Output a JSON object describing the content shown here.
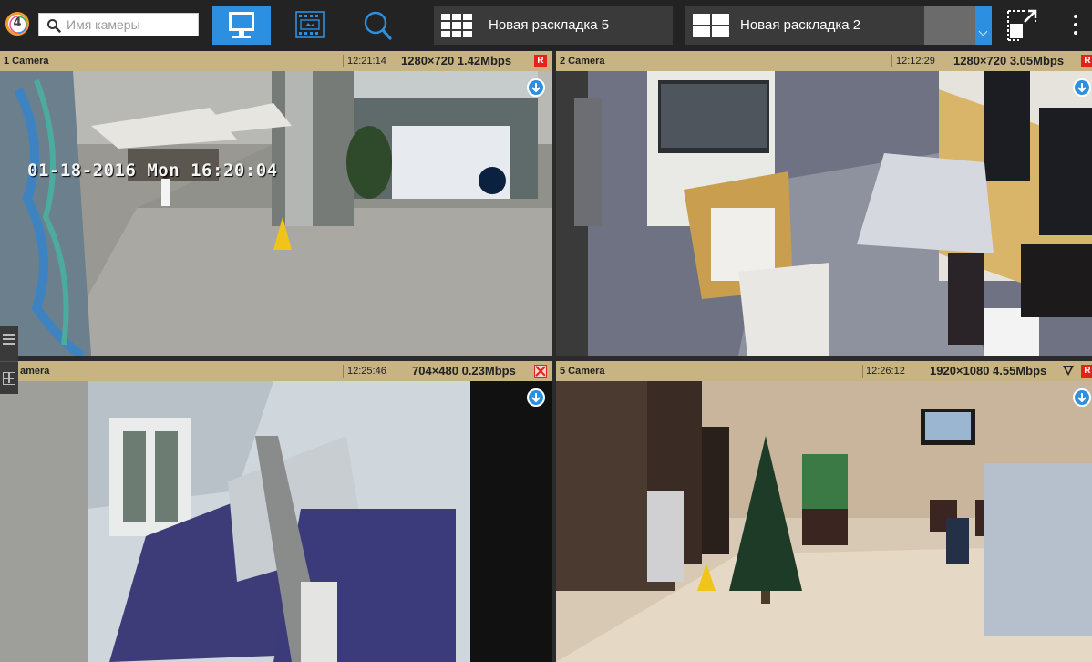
{
  "app": {
    "logo_digit": "4",
    "accent_color": "#2d8fe0",
    "header_color": "#c8b483",
    "rec_color": "#e2231a"
  },
  "toolbar": {
    "search": {
      "placeholder": "Имя камеры",
      "value": ""
    },
    "modes": [
      {
        "name": "live",
        "icon": "monitor-icon",
        "active": true
      },
      {
        "name": "archive",
        "icon": "film-icon",
        "active": false
      },
      {
        "name": "search",
        "icon": "magnifier-icon",
        "active": false
      }
    ],
    "layout_tabs": [
      {
        "label": "Новая раскладка 5",
        "icon": "layout-grid-3x3-icon"
      },
      {
        "label": "Новая раскладка 2",
        "icon": "layout-grid-2x2-icon"
      }
    ],
    "fullscreen_icon": "fullscreen-icon",
    "menu_icon": "kebab-menu-icon"
  },
  "cameras": [
    {
      "name": "1 Camera",
      "time": "12:21:14",
      "stream": "1280×720 1.42Mbps",
      "rec": "R",
      "recording": true,
      "osd": "01-18-2016 Mon 16:20:04"
    },
    {
      "name": "2 Camera",
      "time": "12:12:29",
      "stream": "1280×720 3.05Mbps",
      "rec": "R",
      "recording": true
    },
    {
      "name": "amera",
      "time": "12:25:46",
      "stream": "704×480 0.23Mbps",
      "rec": "",
      "recording": false
    },
    {
      "name": "5 Camera",
      "time": "12:26:12",
      "stream": "1920×1080 4.55Mbps",
      "rec": "R",
      "recording": true,
      "filter_icon": "filter-triangle-icon"
    }
  ]
}
